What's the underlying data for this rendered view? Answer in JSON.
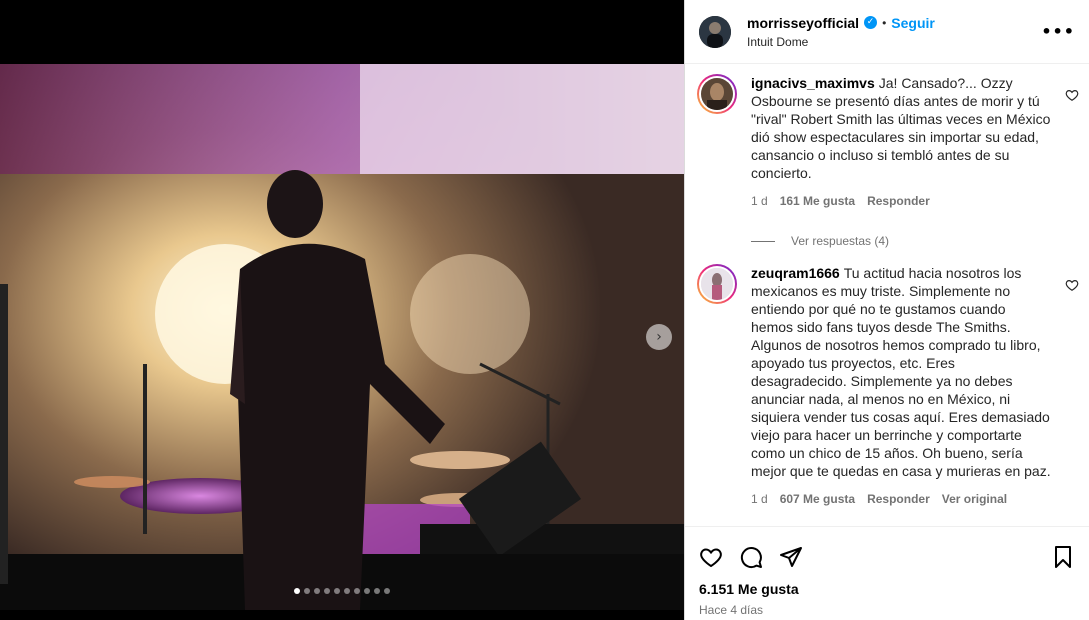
{
  "post": {
    "account": {
      "username": "morrisseyofficial",
      "verified_icon": "verified-badge-icon",
      "separator": "•",
      "follow_label": "Seguir",
      "location": "Intuit Dome",
      "more_label": "•••"
    },
    "media": {
      "next_label": "›",
      "carousel_count": 10,
      "carousel_active_index": 0
    },
    "comments": [
      {
        "username": "ignacivs_maximvs",
        "text": "Ja! Cansado?... Ozzy Osbourne se presentó días antes de morir y tú \"rival\" Robert Smith las últimas veces en México dió show espectaculares sin importar su edad, cansancio o incluso si tembló antes de su concierto.",
        "time": "1 d",
        "likes": "161 Me gusta",
        "reply_label": "Responder",
        "view_replies": "Ver respuestas (4)"
      },
      {
        "username": "zeuqram1666",
        "text": "Tu actitud hacia nosotros los mexicanos es muy triste. Simplemente no entiendo por qué no te gustamos cuando hemos sido fans tuyos desde The Smiths. Algunos de nosotros hemos comprado tu libro, apoyado tus proyectos, etc. Eres desagradecido. Simplemente ya no debes anunciar nada, al menos no en México, ni siquiera vender tus cosas aquí. Eres demasiado viejo para hacer un berrinche y comportarte como un chico de 15 años. Oh bueno, sería mejor que te quedas en casa y murieras en paz.",
        "time": "1 d",
        "likes": "607 Me gusta",
        "reply_label": "Responder",
        "see_original": "Ver original"
      }
    ],
    "likes_total": "6.151 Me gusta",
    "posted_ago": "Hace 4 días"
  },
  "colors": {
    "accent": "#0095f6",
    "muted_text": "#737373",
    "stage_purple": "#c45bd6"
  }
}
